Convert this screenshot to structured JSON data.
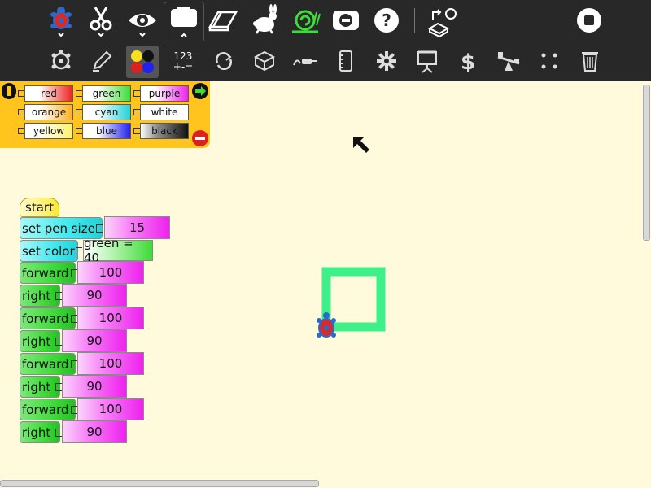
{
  "toolbar": {
    "tabs": [
      "turtle-activity-icon",
      "edit-icon",
      "view-icon",
      "palette-toolbar-icon",
      "eraser-icon",
      "run-fast-icon",
      "run-slow-icon",
      "stop-turtle-icon",
      "help-icon",
      "load-export-icon",
      "stop-icon"
    ],
    "palettes": [
      "turtle-palette-icon",
      "pen-palette-icon",
      "colors-palette-icon",
      "numbers-palette-icon",
      "flow-palette-icon",
      "blocks-palette-icon",
      "sensors-palette-icon",
      "media-palette-icon",
      "extras-palette-icon",
      "presentation-palette-icon",
      "portfolio-palette-icon",
      "myblocks-palette-icon",
      "turtle-misc-icon",
      "trash-icon"
    ],
    "numbers_label_top": "123",
    "numbers_label_bottom": "+-="
  },
  "color_palette": {
    "blocks": [
      {
        "label": "red",
        "color": "#EE2222"
      },
      {
        "label": "green",
        "color": "#3FDB3A"
      },
      {
        "label": "purple",
        "color": "#EE22EE"
      },
      {
        "label": "orange",
        "color": "#FFB020"
      },
      {
        "label": "cyan",
        "color": "#21D3D8"
      },
      {
        "label": "white",
        "color": "#FFFFFF"
      },
      {
        "label": "yellow",
        "color": "#FFF06A"
      },
      {
        "label": "blue",
        "color": "#2222EE"
      },
      {
        "label": "black",
        "color": "#111111"
      }
    ]
  },
  "program": {
    "start": "start",
    "set_pen_size": "set pen size",
    "pen_size_value": "15",
    "set_color": "set color",
    "color_value": "green = 40",
    "steps": [
      {
        "cmd": "forward",
        "value": "100"
      },
      {
        "cmd": "right",
        "value": "90"
      },
      {
        "cmd": "forward",
        "value": "100"
      },
      {
        "cmd": "right",
        "value": "90"
      },
      {
        "cmd": "forward",
        "value": "100"
      },
      {
        "cmd": "right",
        "value": "90"
      },
      {
        "cmd": "forward",
        "value": "100"
      },
      {
        "cmd": "right",
        "value": "90"
      }
    ]
  },
  "drawing": {
    "pen_color": "#3DF08A"
  }
}
